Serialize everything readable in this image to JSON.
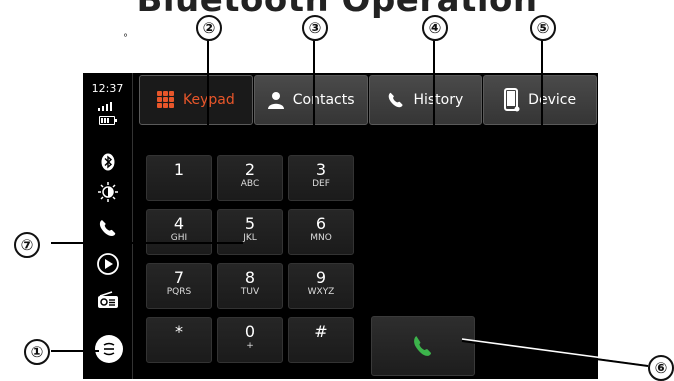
{
  "title": "Bluetooth Operation",
  "dot": "°",
  "status": {
    "time": "12:37"
  },
  "tabs": [
    {
      "label": "Keypad",
      "icon": "keypad-grid-icon",
      "active": true
    },
    {
      "label": "Contacts",
      "icon": "person-icon",
      "active": false
    },
    {
      "label": "History",
      "icon": "phone-icon",
      "active": false
    },
    {
      "label": "Device",
      "icon": "smartphone-icon",
      "active": false
    }
  ],
  "keypad": [
    {
      "digit": "1",
      "letters": ""
    },
    {
      "digit": "2",
      "letters": "ABC"
    },
    {
      "digit": "3",
      "letters": "DEF"
    },
    {
      "digit": "4",
      "letters": "GHI"
    },
    {
      "digit": "5",
      "letters": "JKL"
    },
    {
      "digit": "6",
      "letters": "MNO"
    },
    {
      "digit": "7",
      "letters": "PQRS"
    },
    {
      "digit": "8",
      "letters": "TUV"
    },
    {
      "digit": "9",
      "letters": "WXYZ"
    },
    {
      "digit": "*",
      "letters": ""
    },
    {
      "digit": "0",
      "letters": "+"
    },
    {
      "digit": "#",
      "letters": ""
    }
  ],
  "callouts": [
    "①",
    "②",
    "③",
    "④",
    "⑤",
    "⑥",
    "⑦"
  ],
  "colors": {
    "accent": "#e8562a",
    "call_green": "#3cb44b",
    "screen_bg": "#000000"
  }
}
